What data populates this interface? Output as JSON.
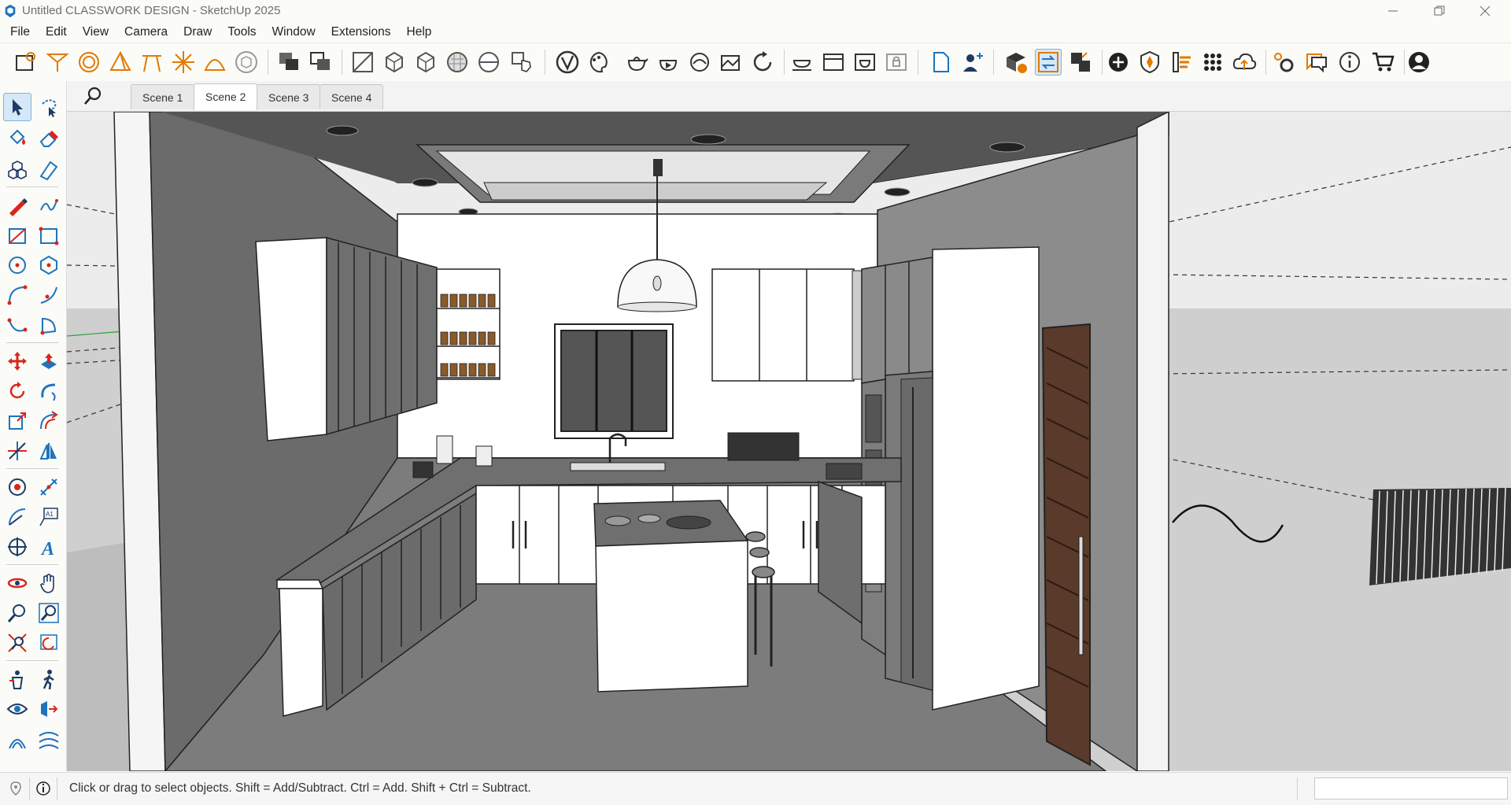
{
  "window": {
    "title": "Untitled CLASSWORK DESIGN - SketchUp 2025",
    "controls": [
      "minimize-icon",
      "restore-icon",
      "close-icon"
    ]
  },
  "menu": {
    "items": [
      "File",
      "Edit",
      "View",
      "Camera",
      "Draw",
      "Tools",
      "Window",
      "Extensions",
      "Help"
    ]
  },
  "scenes": {
    "tabs": [
      {
        "label": "Scene 1",
        "active": false
      },
      {
        "label": "Scene 2",
        "active": true
      },
      {
        "label": "Scene 3",
        "active": false
      },
      {
        "label": "Scene 4",
        "active": false
      }
    ]
  },
  "status": {
    "hint": "Click or drag to select objects. Shift = Add/Subtract. Ctrl = Add. Shift + Ctrl = Subtract.",
    "measurements_value": ""
  },
  "colors": {
    "accent": "#1e73be",
    "tool_orange": "#e07b00",
    "tool_red": "#d9261c",
    "wall_dark": "#6b6b6b",
    "floor": "#7c7c7c",
    "door_wood": "#5a3a2a"
  }
}
